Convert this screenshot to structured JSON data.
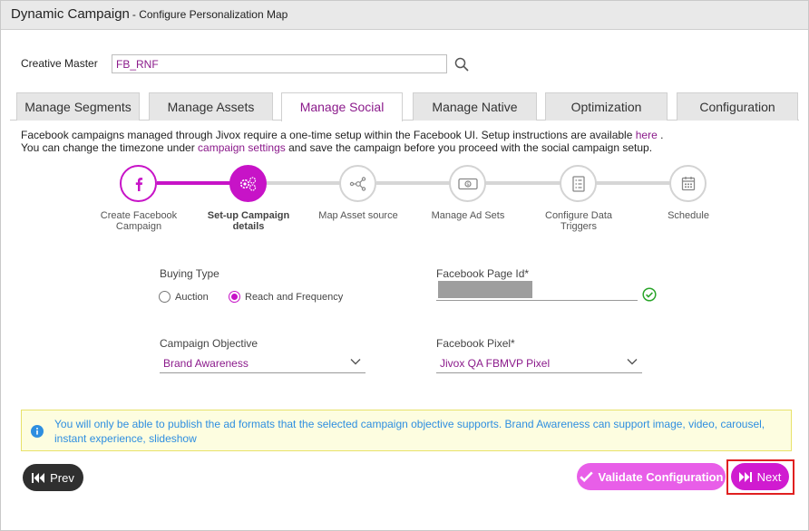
{
  "window": {
    "title": "Dynamic Campaign",
    "subtitle": "- Configure Personalization Map"
  },
  "creative_master": {
    "label": "Creative Master",
    "value": "FB_RNF",
    "search_icon": "search-icon"
  },
  "tabs": [
    {
      "label": "Manage Segments",
      "active": false
    },
    {
      "label": "Manage Assets",
      "active": false
    },
    {
      "label": "Manage Social",
      "active": true
    },
    {
      "label": "Manage Native",
      "active": false
    },
    {
      "label": "Optimization",
      "active": false
    },
    {
      "label": "Configuration",
      "active": false
    }
  ],
  "info": {
    "line1_pre": "Facebook campaigns managed through Jivox require a one-time setup within the Facebook UI. Setup instructions are available ",
    "line1_link": "here",
    "line1_post": " .",
    "line2_pre": "You can change the timezone under ",
    "line2_link": "campaign settings",
    "line2_post": " and save the campaign before you proceed with the social campaign setup."
  },
  "steps": [
    {
      "label": "Create Facebook Campaign",
      "icon": "facebook-icon",
      "state": "done"
    },
    {
      "label": "Set-up Campaign details",
      "icon": "gears-icon",
      "state": "current"
    },
    {
      "label": "Map Asset source",
      "icon": "network-icon",
      "state": "todo"
    },
    {
      "label": "Manage Ad Sets",
      "icon": "money-icon",
      "state": "todo"
    },
    {
      "label": "Configure Data Triggers",
      "icon": "list-icon",
      "state": "todo"
    },
    {
      "label": "Schedule",
      "icon": "calendar-icon",
      "state": "todo"
    }
  ],
  "form": {
    "buying_type": {
      "label": "Buying Type",
      "options": [
        "Auction",
        "Reach and Frequency"
      ],
      "selected": "Reach and Frequency"
    },
    "page_id": {
      "label": "Facebook Page Id*",
      "valid_icon": "check-circle-icon"
    },
    "objective": {
      "label": "Campaign Objective",
      "value": "Brand Awareness"
    },
    "pixel": {
      "label": "Facebook Pixel*",
      "value": "Jivox QA FBMVP Pixel"
    }
  },
  "notice": {
    "icon": "info-icon",
    "text": "You will only be able to publish the ad formats that the selected campaign objective supports. Brand Awareness can support image, video, carousel, instant experience, slideshow"
  },
  "buttons": {
    "prev": "Prev",
    "validate": "Validate Configuration",
    "next": "Next"
  },
  "colors": {
    "accent": "#c713c7",
    "link": "#8b1a8b",
    "notice_text": "#2e8ee0",
    "notice_bg": "#fdfde0",
    "valid": "#2aa52a",
    "highlight": "#e02020"
  }
}
